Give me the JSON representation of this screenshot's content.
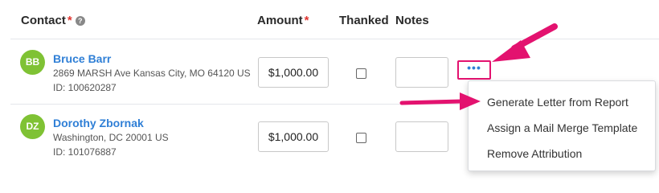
{
  "header": {
    "contact": "Contact",
    "required_mark": "*",
    "help_glyph": "?",
    "amount": "Amount",
    "thanked": "Thanked",
    "notes": "Notes"
  },
  "rows": [
    {
      "initials": "BB",
      "name": "Bruce Barr",
      "address": "2869 MARSH Ave Kansas City, MO 64120 US",
      "id": "ID: 100620287",
      "amount": "$1,000.00",
      "thanked": false,
      "notes": ""
    },
    {
      "initials": "DZ",
      "name": "Dorothy Zbornak",
      "address": "Washington, DC 20001 US",
      "id": "ID: 101076887",
      "amount": "$1,000.00",
      "thanked": false,
      "notes": ""
    }
  ],
  "more_button": {
    "label": "•••"
  },
  "menu": {
    "items": [
      "Generate Letter from Report",
      "Assign a Mail Merge Template",
      "Remove Attribution"
    ]
  },
  "colors": {
    "accent_link": "#2f7fd6",
    "avatar": "#7fc234",
    "required": "#e0342f",
    "annotation_arrow": "#e3126f"
  },
  "icons": [
    "help-icon",
    "annotation-arrow-icon"
  ]
}
